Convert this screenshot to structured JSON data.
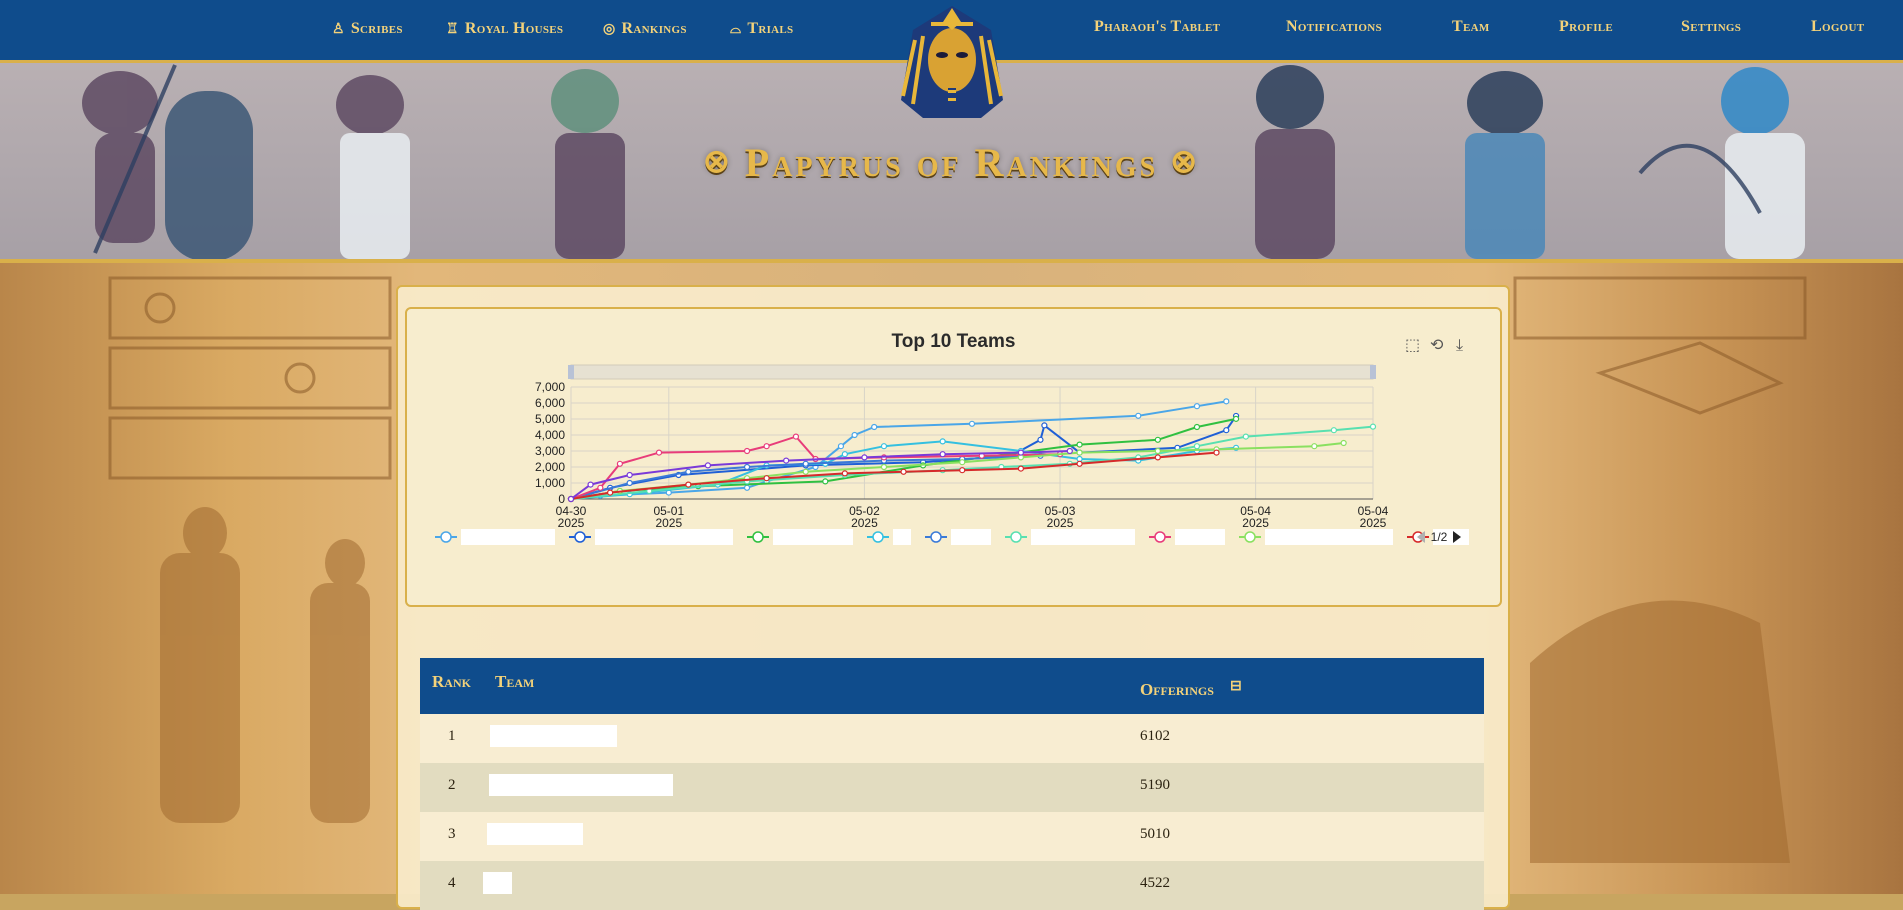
{
  "nav": {
    "left": [
      {
        "label": "Scribes",
        "icon": "scribe-icon",
        "glyph": "♙"
      },
      {
        "label": "Royal Houses",
        "icon": "royal-house-icon",
        "glyph": "♖"
      },
      {
        "label": "Rankings",
        "icon": "rankings-icon",
        "glyph": "◎"
      },
      {
        "label": "Trials",
        "icon": "trials-icon",
        "glyph": "⌓"
      }
    ],
    "right": [
      {
        "label": "Pharaoh's Tablet"
      },
      {
        "label": "Notifications"
      },
      {
        "label": "Team"
      },
      {
        "label": "Profile"
      },
      {
        "label": "Settings"
      },
      {
        "label": "Logout"
      }
    ]
  },
  "banner": {
    "title": "Papyrus of Rankings",
    "mark": "⊗"
  },
  "chart_data": {
    "type": "line",
    "title": "Top 10 Teams",
    "xlabel": "",
    "ylabel": "",
    "ylim": [
      0,
      7000
    ],
    "yticks": [
      "0",
      "1,000",
      "2,000",
      "3,000",
      "4,000",
      "5,000",
      "6,000",
      "7,000"
    ],
    "xticks": [
      {
        "day": 0,
        "label": "04-30",
        "year": "2025"
      },
      {
        "day": 0.5,
        "label": "05-01",
        "year": "2025"
      },
      {
        "day": 1.5,
        "label": "05-02",
        "year": "2025"
      },
      {
        "day": 2.5,
        "label": "05-03",
        "year": "2025"
      },
      {
        "day": 3.5,
        "label": "05-04",
        "year": "2025"
      },
      {
        "day": 4.1,
        "label": "05-04",
        "year": "2025"
      }
    ],
    "grid": true,
    "legend_placement": "bottom",
    "legend_page": "1/2",
    "series": [
      {
        "color": "#4aa6e8",
        "points": [
          [
            0,
            0
          ],
          [
            0.15,
            200
          ],
          [
            0.5,
            400
          ],
          [
            0.9,
            700
          ],
          [
            1.0,
            1100
          ],
          [
            1.25,
            2000
          ],
          [
            1.38,
            3300
          ],
          [
            1.45,
            4000
          ],
          [
            1.55,
            4500
          ],
          [
            2.05,
            4700
          ],
          [
            2.9,
            5200
          ],
          [
            3.2,
            5800
          ],
          [
            3.35,
            6102
          ]
        ]
      },
      {
        "color": "#1f5fd6",
        "points": [
          [
            0,
            0
          ],
          [
            0.2,
            700
          ],
          [
            0.55,
            1500
          ],
          [
            1.2,
            2100
          ],
          [
            1.8,
            2300
          ],
          [
            2.25,
            2700
          ],
          [
            2.4,
            3700
          ],
          [
            2.42,
            4600
          ],
          [
            2.6,
            2900
          ],
          [
            3.1,
            3200
          ],
          [
            3.35,
            4300
          ],
          [
            3.4,
            5190
          ]
        ]
      },
      {
        "color": "#30c040",
        "points": [
          [
            0,
            0
          ],
          [
            0.25,
            500
          ],
          [
            0.65,
            800
          ],
          [
            1.3,
            1100
          ],
          [
            1.8,
            2100
          ],
          [
            2.6,
            3400
          ],
          [
            3.0,
            3700
          ],
          [
            3.2,
            4500
          ],
          [
            3.4,
            5010
          ]
        ]
      },
      {
        "color": "#35c0e0",
        "points": [
          [
            0,
            0
          ],
          [
            0.3,
            300
          ],
          [
            0.75,
            900
          ],
          [
            1.0,
            2100
          ],
          [
            1.3,
            2200
          ],
          [
            1.4,
            2800
          ],
          [
            1.6,
            3300
          ],
          [
            1.9,
            3600
          ],
          [
            2.3,
            3000
          ],
          [
            2.6,
            2500
          ],
          [
            2.9,
            2400
          ],
          [
            3.2,
            3000
          ],
          [
            3.4,
            3200
          ]
        ]
      },
      {
        "color": "#3a7ad8",
        "points": [
          [
            0,
            0
          ],
          [
            0.3,
            1000
          ],
          [
            0.6,
            1700
          ],
          [
            0.9,
            2000
          ],
          [
            1.2,
            2200
          ],
          [
            1.6,
            2400
          ],
          [
            2.0,
            2500
          ],
          [
            2.4,
            2700
          ]
        ]
      },
      {
        "color": "#58e0b0",
        "points": [
          [
            0,
            0
          ],
          [
            0.4,
            500
          ],
          [
            0.9,
            1100
          ],
          [
            1.4,
            1500
          ],
          [
            1.9,
            1800
          ],
          [
            2.2,
            2000
          ],
          [
            2.55,
            2200
          ],
          [
            2.9,
            2600
          ],
          [
            3.2,
            3300
          ],
          [
            3.45,
            3900
          ],
          [
            3.9,
            4300
          ],
          [
            4.1,
            4522
          ]
        ]
      },
      {
        "color": "#e83c7a",
        "points": [
          [
            0,
            0
          ],
          [
            0.15,
            700
          ],
          [
            0.25,
            2200
          ],
          [
            0.45,
            2900
          ],
          [
            0.9,
            3000
          ],
          [
            1.0,
            3300
          ],
          [
            1.15,
            3900
          ],
          [
            1.25,
            2500
          ],
          [
            1.6,
            2600
          ],
          [
            2.1,
            2700
          ],
          [
            2.5,
            2800
          ]
        ]
      },
      {
        "color": "#8ae060",
        "points": [
          [
            0,
            0
          ],
          [
            0.25,
            500
          ],
          [
            0.6,
            900
          ],
          [
            0.9,
            1300
          ],
          [
            1.2,
            1700
          ],
          [
            1.6,
            2000
          ],
          [
            2.0,
            2300
          ],
          [
            2.3,
            2600
          ],
          [
            2.6,
            2900
          ],
          [
            3.0,
            3000
          ],
          [
            3.3,
            3100
          ],
          [
            3.8,
            3300
          ],
          [
            3.95,
            3500
          ]
        ]
      },
      {
        "color": "#d62a2a",
        "points": [
          [
            0,
            0
          ],
          [
            0.2,
            400
          ],
          [
            0.6,
            900
          ],
          [
            1.0,
            1300
          ],
          [
            1.4,
            1600
          ],
          [
            1.7,
            1700
          ],
          [
            2.0,
            1800
          ],
          [
            2.3,
            1900
          ],
          [
            2.6,
            2200
          ],
          [
            3.0,
            2600
          ],
          [
            3.3,
            2900
          ]
        ]
      },
      {
        "color": "#7a3ad8",
        "points": [
          [
            0,
            0
          ],
          [
            0.1,
            900
          ],
          [
            0.3,
            1500
          ],
          [
            0.7,
            2100
          ],
          [
            1.1,
            2400
          ],
          [
            1.5,
            2600
          ],
          [
            1.9,
            2800
          ],
          [
            2.3,
            2900
          ],
          [
            2.55,
            3000
          ]
        ]
      }
    ],
    "legend": [
      {
        "color": "#4aa6e8",
        "mask_w": 94
      },
      {
        "color": "#1f5fd6",
        "mask_w": 138
      },
      {
        "color": "#30c040",
        "mask_w": 80
      },
      {
        "color": "#35c0e0",
        "mask_w": 18
      },
      {
        "color": "#3a7ad8",
        "mask_w": 40
      },
      {
        "color": "#58e0b0",
        "mask_w": 104
      },
      {
        "color": "#e83c7a",
        "mask_w": 50
      },
      {
        "color": "#8ae060",
        "mask_w": 128
      },
      {
        "color": "#d62a2a",
        "mask_w": 36
      }
    ]
  },
  "table": {
    "headers": {
      "rank": "Rank",
      "team": "Team",
      "offerings": "Offerings"
    },
    "rows": [
      {
        "rank": "1",
        "offerings": "6102",
        "mask_x": 70,
        "mask_w": 127
      },
      {
        "rank": "2",
        "offerings": "5190",
        "mask_x": 69,
        "mask_w": 184
      },
      {
        "rank": "3",
        "offerings": "5010",
        "mask_x": 67,
        "mask_w": 96
      },
      {
        "rank": "4",
        "offerings": "4522",
        "mask_x": 63,
        "mask_w": 29
      }
    ]
  },
  "colors": {
    "nav_bg": "#0f4c8c",
    "gold": "#d9b04a",
    "gold_text": "#f3d27a",
    "title_gold": "#e7b84a"
  }
}
